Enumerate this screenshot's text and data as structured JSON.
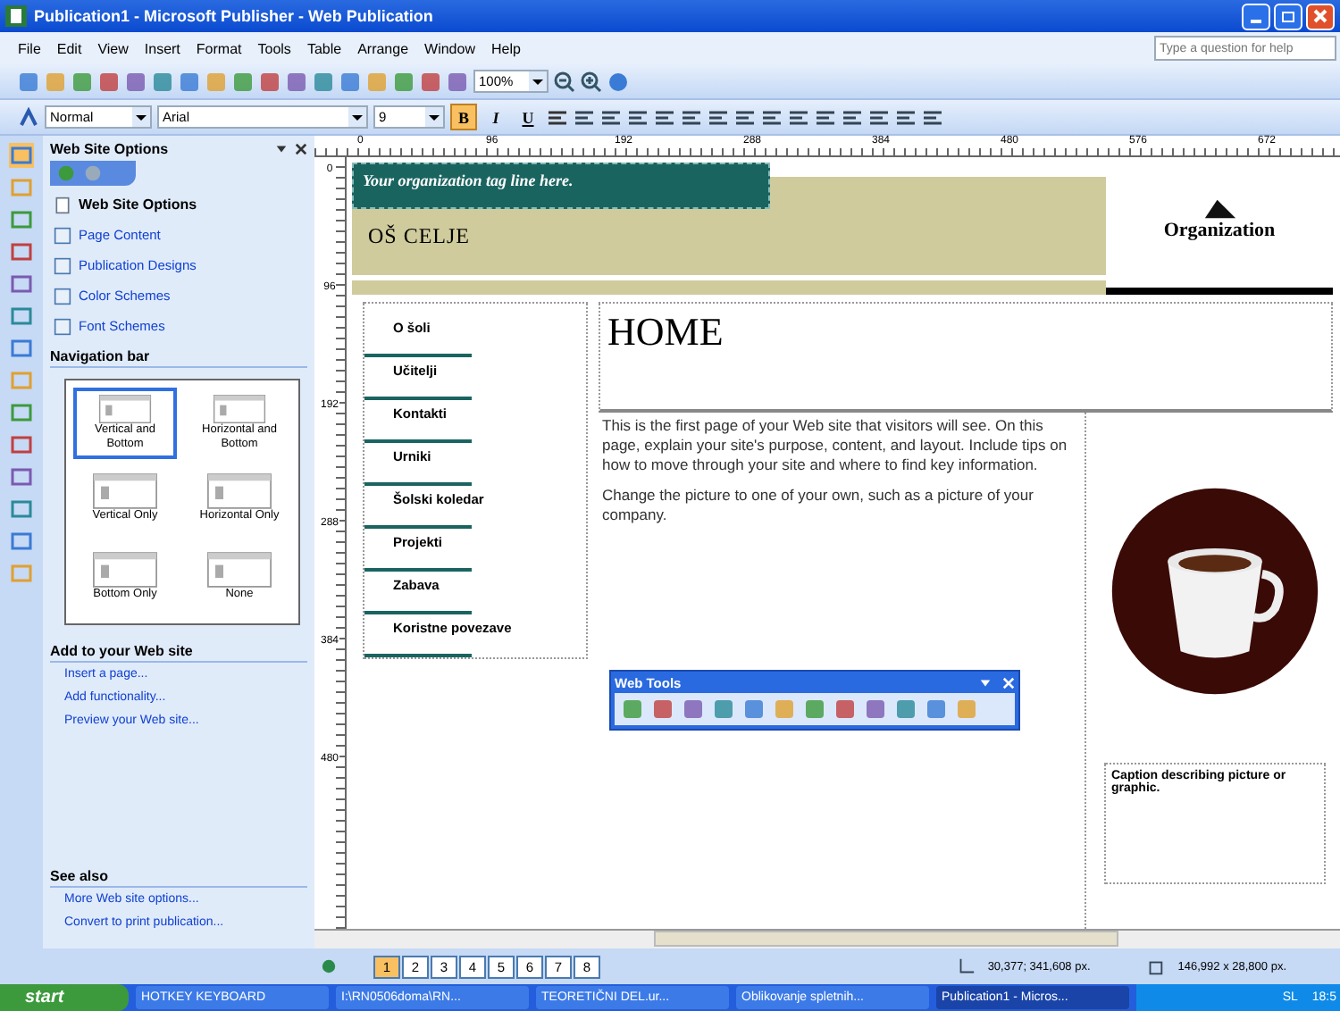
{
  "window": {
    "title": "Publication1 - Microsoft Publisher - Web Publication",
    "help_placeholder": "Type a question for help"
  },
  "menu": [
    "File",
    "Edit",
    "View",
    "Insert",
    "Format",
    "Tools",
    "Table",
    "Arrange",
    "Window",
    "Help"
  ],
  "standard_toolbar": {
    "zoom": "100%"
  },
  "format_toolbar": {
    "style": "Normal",
    "font": "Arial",
    "size": "9",
    "buttons": [
      {
        "label": "B",
        "selected": true
      },
      {
        "label": "I",
        "selected": false
      },
      {
        "label": "U",
        "selected": false
      }
    ]
  },
  "ruler": {
    "horizontal": [
      "0",
      "96",
      "192",
      "288",
      "384",
      "480",
      "576",
      "672"
    ],
    "vertical": [
      "0",
      "96",
      "192",
      "288",
      "384",
      "480"
    ]
  },
  "task_pane": {
    "title": "Web Site Options",
    "items": [
      {
        "kind": "header",
        "label": "Web Site Options"
      },
      {
        "kind": "link",
        "label": "Page Content"
      },
      {
        "kind": "link",
        "label": "Publication Designs"
      },
      {
        "kind": "link",
        "label": "Color Schemes"
      },
      {
        "kind": "link",
        "label": "Font Schemes"
      }
    ],
    "navigation_bar": {
      "title": "Navigation bar",
      "options": [
        {
          "label": "Vertical and Bottom",
          "selected": true
        },
        {
          "label": "Horizontal and Bottom",
          "selected": false
        },
        {
          "label": "Vertical Only",
          "selected": false
        },
        {
          "label": "Horizontal Only",
          "selected": false
        },
        {
          "label": "Bottom Only",
          "selected": false
        },
        {
          "label": "None",
          "selected": false
        }
      ]
    },
    "add_section": {
      "title": "Add to your Web site",
      "links": [
        "Insert a page...",
        "Add functionality...",
        "Preview your Web site..."
      ]
    },
    "see_also": {
      "title": "See also",
      "links": [
        "More Web site options...",
        "Convert to print publication..."
      ]
    }
  },
  "publication": {
    "tagline": "Your organization tag line here.",
    "organization_name": "OŠ CELJE",
    "logo_text": "Organization",
    "nav_links": [
      "O šoli",
      "Učitelji",
      "Kontakti",
      "Urniki",
      "Šolski koledar",
      "Projekti",
      "Zabava",
      "Koristne povezave"
    ],
    "heading": "HOME",
    "paragraphs": [
      "This is the first page of your Web site that visitors will see. On this page, explain your site's purpose, content, and layout. Include tips on how to move through your site and where to find key information.",
      "Change the picture to one of your own, such as a picture of your company."
    ],
    "caption": "Caption describing picture or graphic."
  },
  "web_tools": {
    "title": "Web Tools"
  },
  "page_tabs": [
    {
      "label": "1",
      "selected": true
    },
    {
      "label": "2",
      "selected": false
    },
    {
      "label": "3",
      "selected": false
    },
    {
      "label": "4",
      "selected": false
    },
    {
      "label": "5",
      "selected": false
    },
    {
      "label": "6",
      "selected": false
    },
    {
      "label": "7",
      "selected": false
    },
    {
      "label": "8",
      "selected": false
    }
  ],
  "status_bar": {
    "position": "30,377; 341,608 px.",
    "size": "146,992 x 28,800 px."
  },
  "taskbar": {
    "start": "start",
    "tasks": [
      {
        "label": "HOTKEY KEYBOARD",
        "selected": false
      },
      {
        "label": "I:\\RN0506doma\\RN...",
        "selected": false
      },
      {
        "label": "TEORETIČNI DEL.ur...",
        "selected": false
      },
      {
        "label": "Oblikovanje spletnih...",
        "selected": false
      },
      {
        "label": "Publication1 - Micros...",
        "selected": true
      }
    ],
    "language": "SL",
    "clock": "18:5"
  }
}
